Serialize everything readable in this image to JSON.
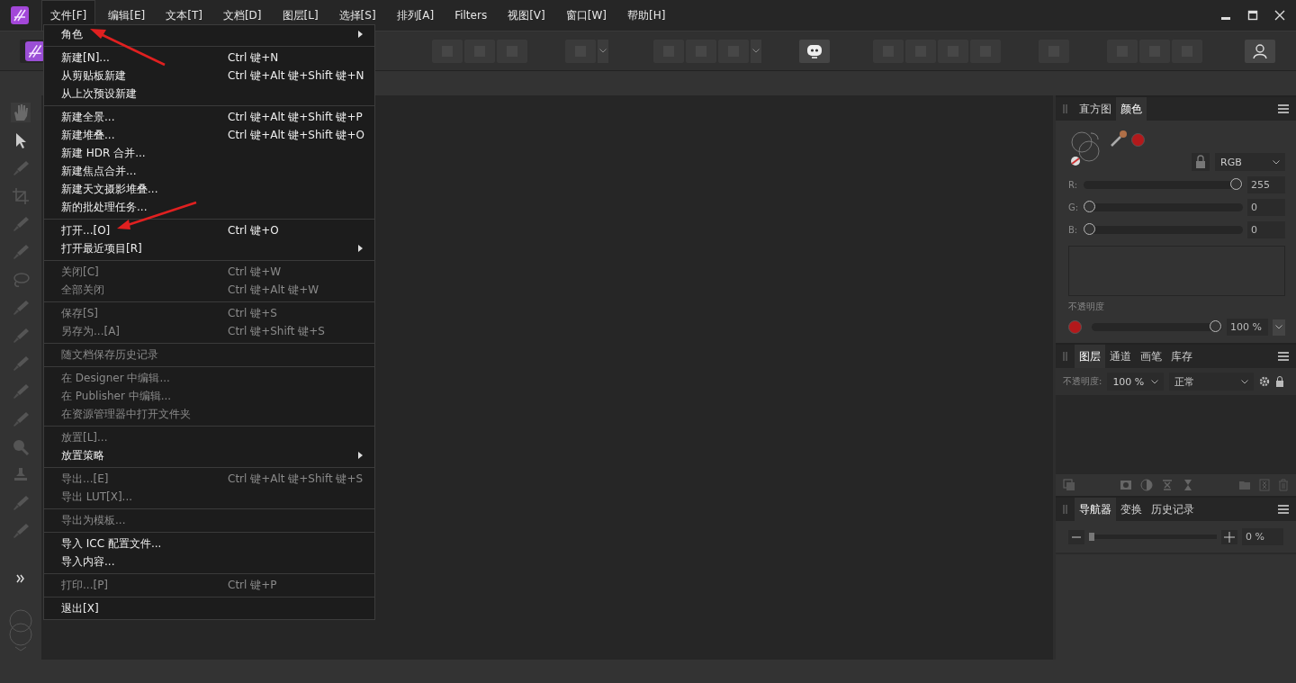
{
  "menubar": [
    {
      "label": "文件[F]",
      "selected": true
    },
    {
      "label": "编辑[E]",
      "selected": false
    },
    {
      "label": "文本[T]",
      "selected": false
    },
    {
      "label": "文档[D]",
      "selected": false
    },
    {
      "label": "图层[L]",
      "selected": false
    },
    {
      "label": "选择[S]",
      "selected": false
    },
    {
      "label": "排列[A]",
      "selected": false
    },
    {
      "label": "Filters",
      "selected": false
    },
    {
      "label": "视图[V]",
      "selected": false
    },
    {
      "label": "窗口[W]",
      "selected": false
    },
    {
      "label": "帮助[H]",
      "selected": false
    }
  ],
  "file_menu": {
    "sections": [
      [
        {
          "label": "角色",
          "disabled": false,
          "submenu": true
        }
      ],
      [
        {
          "label": "新建[N]...",
          "shortcut": "Ctrl 键+N",
          "disabled": false,
          "submenu": false
        },
        {
          "label": "从剪贴板新建",
          "shortcut": "Ctrl 键+Alt 键+Shift 键+N",
          "disabled": false,
          "submenu": false
        },
        {
          "label": "从上次预设新建",
          "disabled": false,
          "submenu": false
        }
      ],
      [
        {
          "label": "新建全景...",
          "shortcut": "Ctrl 键+Alt 键+Shift 键+P",
          "disabled": false,
          "submenu": false
        },
        {
          "label": "新建堆叠...",
          "shortcut": "Ctrl 键+Alt 键+Shift 键+O",
          "disabled": false,
          "submenu": false
        },
        {
          "label": "新建 HDR 合并...",
          "disabled": false,
          "submenu": false
        },
        {
          "label": "新建焦点合并...",
          "disabled": false,
          "submenu": false
        },
        {
          "label": "新建天文摄影堆叠...",
          "disabled": false,
          "submenu": false
        },
        {
          "label": "新的批处理任务...",
          "disabled": false,
          "submenu": false
        }
      ],
      [
        {
          "label": "打开...[O]",
          "shortcut": "Ctrl 键+O",
          "disabled": false,
          "submenu": false
        },
        {
          "label": "打开最近项目[R]",
          "disabled": false,
          "submenu": true
        }
      ],
      [
        {
          "label": "关闭[C]",
          "shortcut": "Ctrl 键+W",
          "disabled": true,
          "submenu": false
        },
        {
          "label": "全部关闭",
          "shortcut": "Ctrl 键+Alt 键+W",
          "disabled": true,
          "submenu": false
        }
      ],
      [
        {
          "label": "保存[S]",
          "shortcut": "Ctrl 键+S",
          "disabled": true,
          "submenu": false
        },
        {
          "label": "另存为...[A]",
          "shortcut": "Ctrl 键+Shift 键+S",
          "disabled": true,
          "submenu": false
        }
      ],
      [
        {
          "label": "随文档保存历史记录",
          "disabled": true,
          "submenu": false
        }
      ],
      [
        {
          "label": "在 Designer 中编辑...",
          "disabled": true,
          "submenu": false
        },
        {
          "label": "在 Publisher 中编辑...",
          "disabled": true,
          "submenu": false
        },
        {
          "label": "在资源管理器中打开文件夹",
          "disabled": true,
          "submenu": false
        }
      ],
      [
        {
          "label": "放置[L]...",
          "disabled": true,
          "submenu": false
        },
        {
          "label": "放置策略",
          "disabled": false,
          "submenu": true
        }
      ],
      [
        {
          "label": "导出...[E]",
          "shortcut": "Ctrl 键+Alt 键+Shift 键+S",
          "disabled": true,
          "submenu": false
        },
        {
          "label": "导出 LUT[X]...",
          "disabled": true,
          "submenu": false
        }
      ],
      [
        {
          "label": "导出为模板...",
          "disabled": true,
          "submenu": false
        }
      ],
      [
        {
          "label": "导入 ICC 配置文件...",
          "disabled": false,
          "submenu": false
        },
        {
          "label": "导入内容...",
          "disabled": false,
          "submenu": false
        }
      ],
      [
        {
          "label": "打印...[P]",
          "shortcut": "Ctrl 键+P",
          "disabled": true,
          "submenu": false
        }
      ],
      [
        {
          "label": "退出[X]",
          "disabled": false,
          "submenu": false
        }
      ]
    ]
  },
  "color_panel": {
    "tabs": [
      {
        "label": "直方图",
        "selected": false
      },
      {
        "label": "颜色",
        "selected": true
      }
    ],
    "mode": "RGB",
    "channels": [
      {
        "label": "R:",
        "level": 1,
        "value": "255"
      },
      {
        "label": "G:",
        "level": 0,
        "value": "0"
      },
      {
        "label": "B:",
        "level": 0,
        "value": "0"
      }
    ],
    "opacity": {
      "label": "不透明度",
      "level": 1,
      "value": "100 %"
    }
  },
  "layers_panel": {
    "tabs": [
      {
        "label": "图层",
        "selected": true
      },
      {
        "label": "通道",
        "selected": false
      },
      {
        "label": "画笔",
        "selected": false
      },
      {
        "label": "库存",
        "selected": false
      }
    ],
    "opacity_label": "不透明度:",
    "opacity": "100 %",
    "blend_mode": "正常"
  },
  "navigator_panel": {
    "tabs": [
      {
        "label": "导航器",
        "selected": true
      },
      {
        "label": "变换",
        "selected": false
      },
      {
        "label": "历史记录",
        "selected": false
      }
    ],
    "zoom": {
      "level": 0,
      "value": "0 %"
    }
  }
}
